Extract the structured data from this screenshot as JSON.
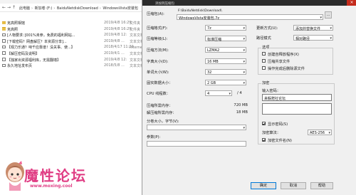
{
  "explorer": {
    "breadcrumb": [
      "此电脑",
      "新加卷 (F:)",
      "BaiduNetdiskDownload",
      "WindowsVista安装包"
    ],
    "files": [
      {
        "name": "克高照相馆",
        "date": "2019/4/8 16:29",
        "type": "文件夹",
        "kind": "folder"
      },
      {
        "name": "克高照",
        "date": "2019/4/8 16:29",
        "type": "文件夹",
        "kind": "folder"
      },
      {
        "name": "[人物要求：]001%未参，免费的福利网站...",
        "date": "2019/4/8 12:",
        "type": "文本文档",
        "kind": "txt"
      },
      {
        "name": "[下载密码？网盘解压？本资源分享]...",
        "date": "2019/4/8 ...",
        "type": "文本文档",
        "kind": "txt"
      },
      {
        "name": "【观力乐通？呐千应靠谱！没关事、使...】",
        "date": "2018/4/17 11:29",
        "type": "Internet 快捷方式",
        "kind": "txt"
      },
      {
        "name": "【解压密码及说明】",
        "date": "2019/4/1 ...",
        "type": "文本文档",
        "kind": "txt"
      },
      {
        "name": "【独家出资源福利库，无需翻墙】",
        "date": "2019/4/8 12:",
        "type": "文本文档",
        "kind": "txt"
      },
      {
        "name": "永久地址发布页",
        "date": "2018/5/8 ...",
        "type": "文本文档",
        "kind": "txt"
      }
    ]
  },
  "dialog": {
    "title": "添加到压缩包",
    "archive_label": "压缩包(A):",
    "archive_path": "F:\\BaiduNetdisk\\Download\\",
    "archive_name": "WindowsVista安装包.7z",
    "browse_label": "...",
    "format_label": "压缩格式(F):",
    "format_value": "7z",
    "level_label": "压缩等级(L):",
    "level_value": "标准压缩",
    "method_label": "压缩方法(M):",
    "method_value": "LZMA2",
    "dict_label": "字典大小(D):",
    "dict_value": "16 MB",
    "word_label": "单词大小(W):",
    "word_value": "32",
    "solid_label": "固实数据大小：",
    "solid_value": "2 GB",
    "cpu_label": "CPU 线程数：",
    "cpu_value": "4",
    "cpu_total": "/ 4",
    "mem_compress_label": "压缩所需内存：",
    "mem_compress_value": "720 MB",
    "mem_decompress_label": "解压缩所需内存：",
    "mem_decompress_value": "18 MB",
    "split_label": "分卷大小，字节(V):",
    "params_label": "参数(P):",
    "update_label": "更新方式(U):",
    "update_value": "添加并替换文件",
    "path_label": "路径模式",
    "path_value": "相对路径",
    "options_title": "选项",
    "opt_sfx": "创建自释放程序(X)",
    "opt_shared": "压缩共享文件",
    "opt_delete": "操作完成后删除源文件",
    "encrypt_title": "加密",
    "password_label": "输入密码：",
    "password_value": "来躲赠社论坛",
    "show_password": "显示密码(S)",
    "enc_method_label": "加密算法：",
    "enc_method_value": "AES-256",
    "encrypt_names": "加密文件名(N)",
    "ok": "确定",
    "cancel": "取消",
    "help": "帮助"
  },
  "watermark": {
    "text": "魔性论坛",
    "url": "www.moxing.cool"
  }
}
